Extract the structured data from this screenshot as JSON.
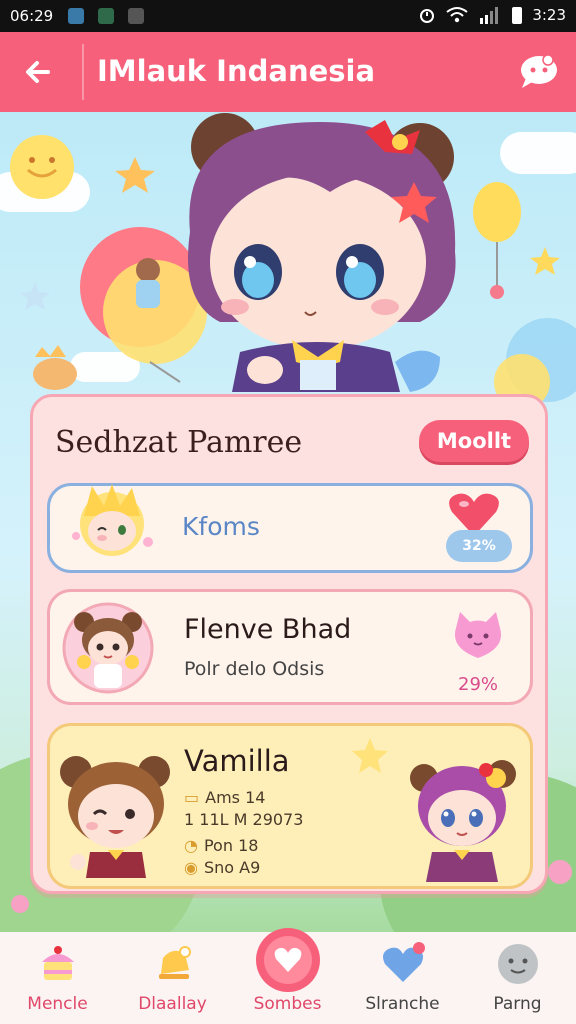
{
  "status_bar": {
    "time": "06:29",
    "clock": "3:23",
    "icons": [
      "gallery-notification-icon",
      "android-notification-icon",
      "sync-notification-icon",
      "alarm-icon",
      "wifi-icon",
      "signal-icon",
      "battery-icon"
    ]
  },
  "app_bar": {
    "title": "IMlauk Indanesia",
    "back_icon": "arrow-left-icon",
    "action_icon": "chat-bubble-icon"
  },
  "panel": {
    "title": "Sedhzat Pamree",
    "action_label": "Moollt",
    "rows": [
      {
        "name": "Kfoms",
        "badge": "32%"
      },
      {
        "name": "Flenve Bhad",
        "subtitle": "Polr delo Odsis",
        "percent": "29%"
      },
      {
        "name": "Vamilla",
        "lines": [
          "Ams 14",
          "1 11L M 29073",
          "Pon 18",
          "Sno A9"
        ]
      }
    ]
  },
  "bottom_nav": {
    "items": [
      {
        "label": "Mencle",
        "color": "#e0476a"
      },
      {
        "label": "Dlaallay",
        "color": "#e0476a"
      },
      {
        "label": "Sombes",
        "color": "#e0476a"
      },
      {
        "label": "Slranche",
        "color": "#444444"
      },
      {
        "label": "Parng",
        "color": "#444444"
      }
    ]
  },
  "colors": {
    "accent": "#f6607a",
    "panel_bg": "#fde1e1",
    "row1_border": "#8ab0e0",
    "row3_bg": "#feefb8"
  }
}
